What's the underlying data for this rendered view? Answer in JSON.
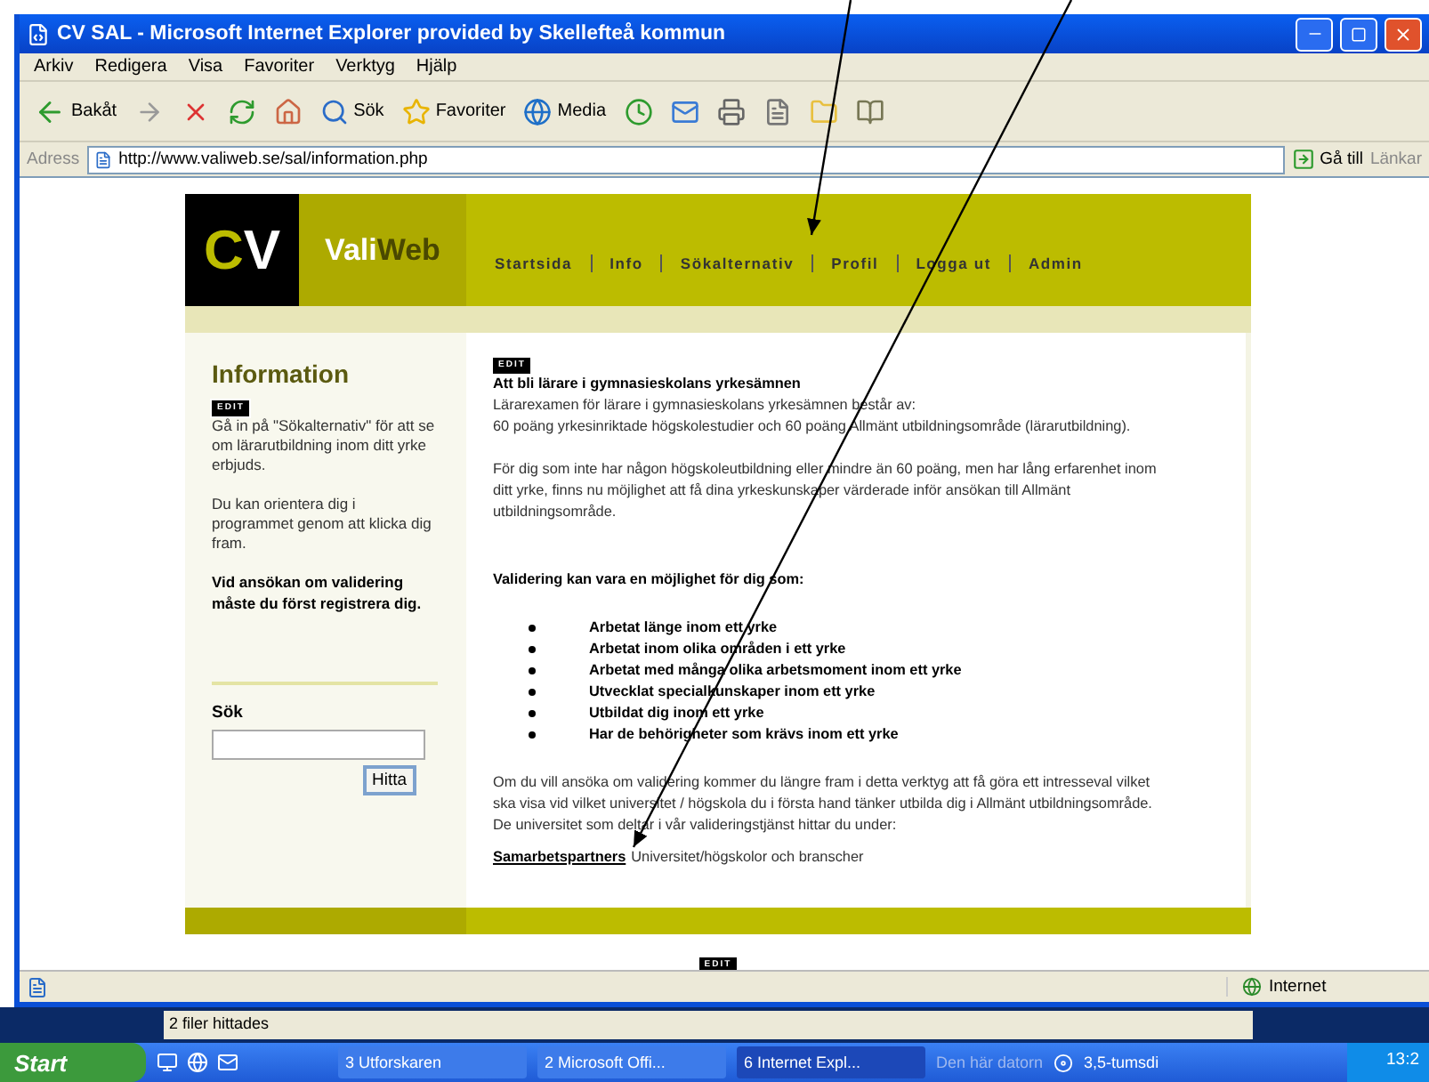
{
  "window": {
    "title": "CV SAL - Microsoft Internet Explorer provided by Skellefteå kommun"
  },
  "menu": [
    "Arkiv",
    "Redigera",
    "Visa",
    "Favoriter",
    "Verktyg",
    "Hjälp"
  ],
  "toolbar": [
    {
      "kind": "back",
      "label": "Bakåt"
    },
    {
      "kind": "forward"
    },
    {
      "kind": "stop"
    },
    {
      "kind": "refresh"
    },
    {
      "kind": "home"
    },
    {
      "kind": "search",
      "label": "Sök"
    },
    {
      "kind": "favorites",
      "label": "Favoriter"
    },
    {
      "kind": "media",
      "label": "Media"
    },
    {
      "kind": "history"
    },
    {
      "kind": "mail"
    },
    {
      "kind": "print"
    },
    {
      "kind": "edit"
    },
    {
      "kind": "folder"
    },
    {
      "kind": "research"
    }
  ],
  "address": {
    "label": "Adress",
    "value": "http://www.valiweb.se/sal/information.php",
    "go": "Gå till",
    "links": "Länkar"
  },
  "site": {
    "logo": {
      "mark": "CV",
      "name_light": "Vali",
      "name_dark": "Web"
    },
    "nav": [
      {
        "label": "Startsida"
      },
      {
        "label": "Info"
      },
      {
        "label": "Sökalternativ"
      },
      {
        "label": "Profil"
      },
      {
        "label": "Logga ut"
      },
      {
        "label": "Admin"
      }
    ],
    "sidebar": {
      "heading": "Information",
      "edit": "EDIT",
      "paragraphs": [
        "Gå in på \"Sökalternativ\" för att se om lärarutbildning inom ditt yrke erbjuds.",
        "Du kan orientera dig i programmet genom att klicka dig fram."
      ],
      "note": "Vid ansökan om validering måste du först registrera dig.",
      "search_label": "Sök",
      "search_button": "Hitta"
    },
    "main": {
      "edit": "EDIT",
      "heading": "Att bli lärare i gymnasieskolans yrkesämnen",
      "intro": [
        "Lärarexamen för lärare i gymnasieskolans yrkesämnen består av:",
        "60 poäng yrkesinriktade högskolestudier och 60 poäng Allmänt utbildningsområde (lärarutbildning)."
      ],
      "paragraph": "För dig som inte har någon högskoleutbildning eller mindre än 60 poäng, men har lång erfarenhet inom ditt yrke, finns nu möjlighet att få dina yrkeskunskaper värderade inför ansökan till Allmänt utbildningsområde.",
      "subheading": "Validering kan vara en möjlighet för dig som:",
      "bullets": [
        "Arbetat länge inom ett yrke",
        "Arbetat inom olika områden i ett yrke",
        "Arbetat med många olika arbetsmoment inom ett yrke",
        "Utvecklat specialkunskaper inom ett yrke",
        "Utbildat dig inom ett yrke",
        "Har de behörigheter som krävs inom ett yrke"
      ],
      "closing": "Om du vill ansöka om validering kommer du längre fram i detta verktyg att få göra ett intresseval vilket ska visa vid vilket universitet / högskola du i första hand tänker utbilda dig i Allmänt utbildningsområde. De universitet som deltar i vår valideringstjänst hittar du under:",
      "link": "Samarbetspartners",
      "link_after": "Universitet/högskolor och branscher"
    },
    "footer_edit": "EDIT"
  },
  "status_bar": {
    "zone": "Internet"
  },
  "search_status": "2 filer hittades",
  "taskbar": {
    "start": "Start",
    "tasks": [
      {
        "label": "3 Utforskaren",
        "selected": false
      },
      {
        "label": "2 Microsoft Offi...",
        "selected": false
      },
      {
        "label": "6 Internet Expl...",
        "selected": true
      }
    ],
    "tray": [
      "Den här datorn",
      "3,5-tumsdi"
    ],
    "clock": "13:2"
  }
}
